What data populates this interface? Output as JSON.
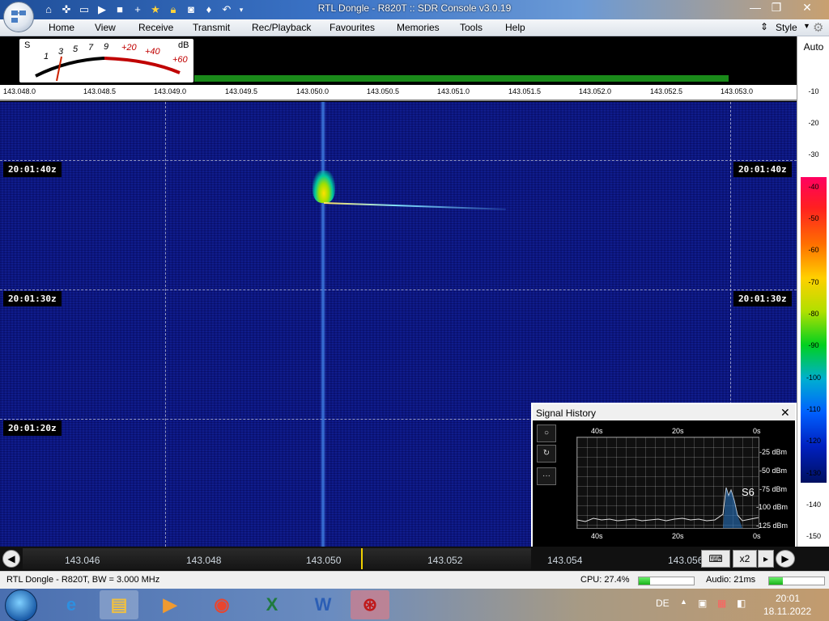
{
  "window": {
    "title": "RTL Dongle - R820T :: SDR Console v3.0.19",
    "controls": {
      "minimize": "—",
      "maximize": "❐",
      "close": "✕"
    }
  },
  "menu": {
    "items": [
      "Home",
      "View",
      "Receive",
      "Transmit",
      "Rec/Playback",
      "Favourites",
      "Memories",
      "Tools",
      "Help"
    ],
    "style_label": "Style"
  },
  "smeter": {
    "s_label": "S",
    "db_label": "dB",
    "scale": [
      "1",
      "3",
      "5",
      "7",
      "9",
      "+20",
      "+40",
      "+60"
    ]
  },
  "freq_ruler": [
    "143.048.0",
    "143.048.5",
    "143.049.0",
    "143.049.5",
    "143.050.0",
    "143.050.5",
    "143.051.0",
    "143.051.5",
    "143.052.0",
    "143.052.5",
    "143.053.0"
  ],
  "waterfall": {
    "timestamps": [
      "20:01:40z",
      "20:01:30z",
      "20:01:20z"
    ]
  },
  "db_scale": {
    "auto_label": "Auto",
    "values": [
      "-10",
      "-20",
      "-30",
      "-40",
      "-50",
      "-60",
      "-70",
      "-80",
      "-90",
      "-100",
      "-110",
      "-120",
      "-130",
      "-140",
      "-150"
    ]
  },
  "signal_history": {
    "title": "Signal History",
    "close": "✕",
    "buttons": [
      "○",
      "↻",
      "···"
    ],
    "x_top": [
      "40s",
      "20s",
      "0s"
    ],
    "x_bottom": [
      "40s",
      "20s",
      "0s"
    ],
    "y_labels": [
      "-25 dBm",
      "-50 dBm",
      "-75 dBm",
      "-100 dBm",
      "-125 dBm"
    ],
    "s_reading": "S6"
  },
  "bottom_strip": {
    "freqs": [
      "143.046",
      "143.048",
      "143.050",
      "143.052",
      "143.054",
      "143.056"
    ],
    "zoom_label": "x2"
  },
  "status": {
    "device": "RTL Dongle - R820T, BW = 3.000 MHz",
    "cpu": "CPU: 27.4%",
    "audio": "Audio: 21ms",
    "cpu_level": 0.2,
    "audio_level": 0.25
  },
  "taskbar": {
    "language": "DE",
    "time": "20:01",
    "date": "18.11.2022"
  }
}
